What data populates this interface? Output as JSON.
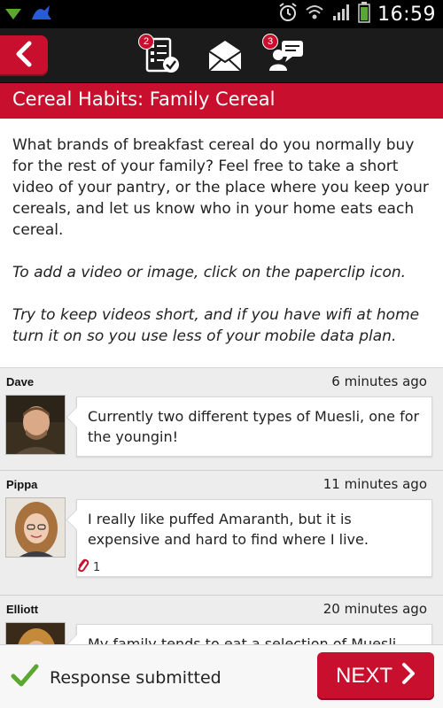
{
  "status_bar": {
    "time": "16:59",
    "icons": [
      "download-icon",
      "app-icon",
      "alarm-icon",
      "wifi-icon",
      "signal-icon",
      "battery-icon"
    ]
  },
  "toolbar": {
    "back_icon": "chevron-left-icon",
    "tasks_badge": "2",
    "messages_icon": "envelope-icon",
    "chat_badge": "3"
  },
  "title": "Cereal Habits: Family Cereal",
  "question": {
    "paragraphs": [
      "What brands of breakfast cereal do you normally buy for the rest of your family? Feel free to take a short video of your pantry, or the place where you keep your cereals, and let us know who in your home eats each cereal.",
      "To add a video or image, click on the paperclip icon.",
      "Try to keep videos short, and if you have wifi at home turn it on so you use less of your mobile data plan."
    ]
  },
  "responses": [
    {
      "name": "Dave",
      "time": "6 minutes ago",
      "text": "Currently two different types of Muesli, one for the youngin!",
      "attachments": ""
    },
    {
      "name": "Pippa",
      "time": "11 minutes ago",
      "text": "I really like puffed Amaranth, but it is expensive and hard to find where I live.",
      "attachments": "1"
    },
    {
      "name": "Elliott",
      "time": "20 minutes ago",
      "text": "My family tends to eat a selection of Muesli",
      "attachments": ""
    }
  ],
  "footer": {
    "status": "Response submitted",
    "next_label": "NEXT"
  },
  "colors": {
    "accent": "#c8102e",
    "toolbar": "#1b1b1b",
    "check": "#5aa832"
  }
}
